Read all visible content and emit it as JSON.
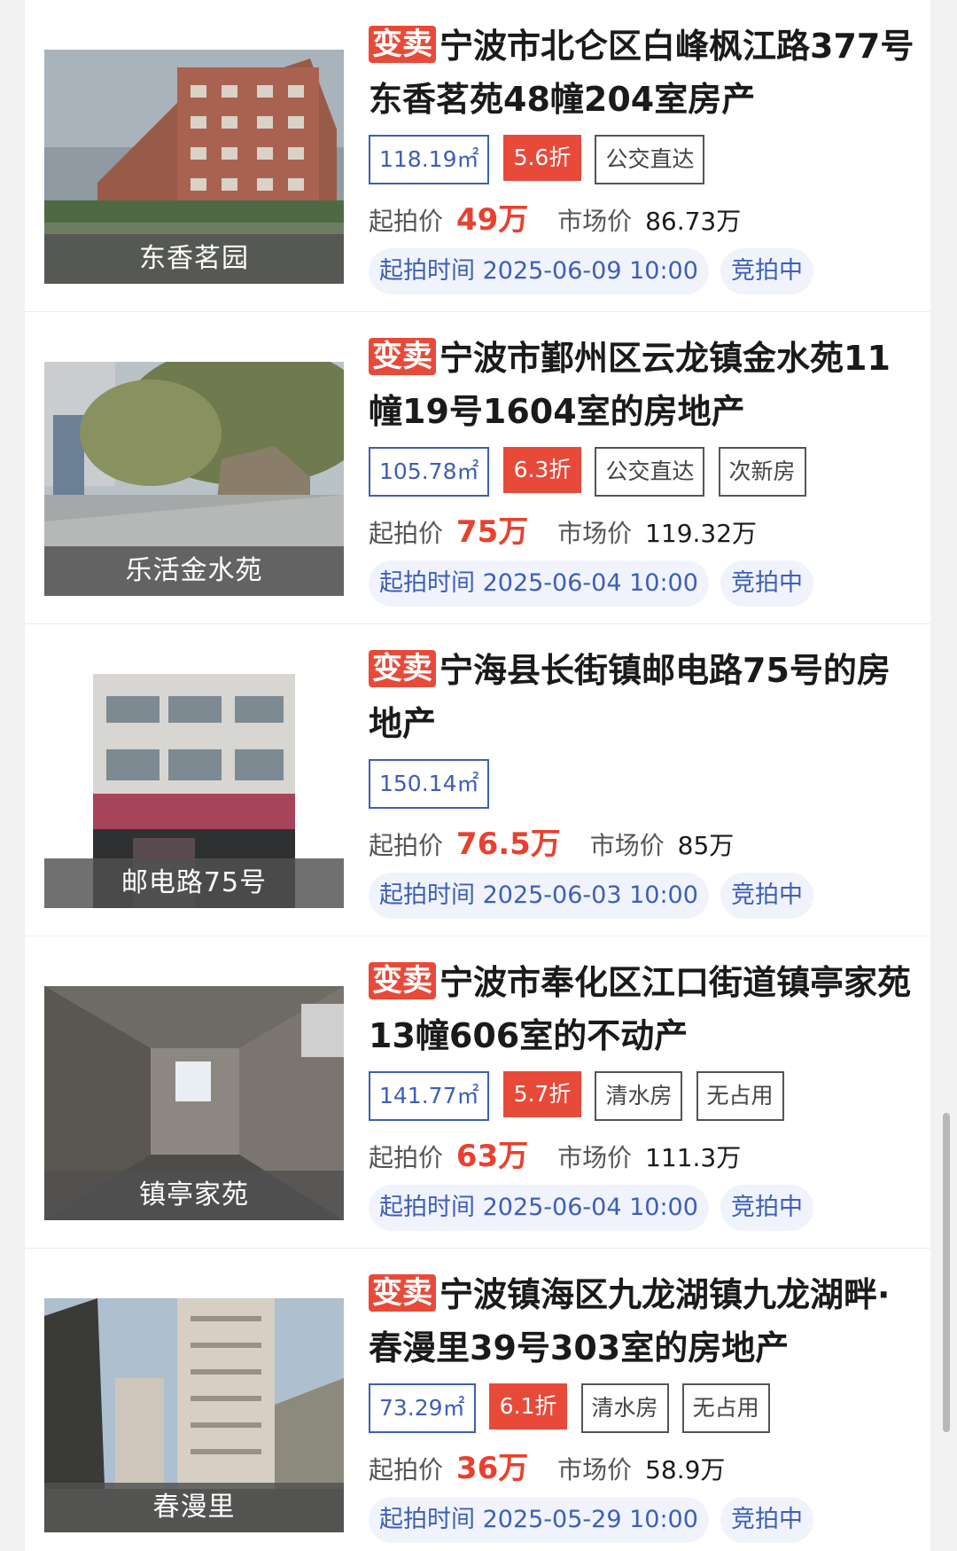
{
  "badge_label": "变卖",
  "start_price_label": "起拍价",
  "market_price_label": "市场价",
  "start_time_label": "起拍时间",
  "listings": [
    {
      "title": "宁波市北仑区白峰枫江路377号东香茗苑48幢204室房产",
      "image_label": "东香茗园",
      "tags": [
        {
          "text": "118.19㎡",
          "kind": "area"
        },
        {
          "text": "5.6折",
          "kind": "discount"
        },
        {
          "text": "公交直达",
          "kind": "plain"
        }
      ],
      "start_price": "49万",
      "market_price": "86.73万",
      "start_time": "2025-06-09 10:00",
      "status": "竞拍中"
    },
    {
      "title": "宁波市鄞州区云龙镇金水苑11幢19号1604室的房地产",
      "image_label": "乐活金水苑",
      "tags": [
        {
          "text": "105.78㎡",
          "kind": "area"
        },
        {
          "text": "6.3折",
          "kind": "discount"
        },
        {
          "text": "公交直达",
          "kind": "plain"
        },
        {
          "text": "次新房",
          "kind": "plain"
        }
      ],
      "start_price": "75万",
      "market_price": "119.32万",
      "start_time": "2025-06-04 10:00",
      "status": "竞拍中"
    },
    {
      "title": "宁海县长街镇邮电路75号的房地产",
      "image_label": "邮电路75号",
      "tags": [
        {
          "text": "150.14㎡",
          "kind": "area"
        }
      ],
      "start_price": "76.5万",
      "market_price": "85万",
      "start_time": "2025-06-03 10:00",
      "status": "竞拍中"
    },
    {
      "title": "宁波市奉化区江口街道镇亭家苑13幢606室的不动产",
      "image_label": "镇亭家苑",
      "tags": [
        {
          "text": "141.77㎡",
          "kind": "area"
        },
        {
          "text": "5.7折",
          "kind": "discount"
        },
        {
          "text": "清水房",
          "kind": "plain"
        },
        {
          "text": "无占用",
          "kind": "plain"
        }
      ],
      "start_price": "63万",
      "market_price": "111.3万",
      "start_time": "2025-06-04 10:00",
      "status": "竞拍中"
    },
    {
      "title": "宁波镇海区九龙湖镇九龙湖畔·春漫里39号303室的房地产",
      "image_label": "春漫里",
      "tags": [
        {
          "text": "73.29㎡",
          "kind": "area"
        },
        {
          "text": "6.1折",
          "kind": "discount"
        },
        {
          "text": "清水房",
          "kind": "plain"
        },
        {
          "text": "无占用",
          "kind": "plain"
        }
      ],
      "start_price": "36万",
      "market_price": "58.9万",
      "start_time": "2025-05-29 10:00",
      "status": "竞拍中"
    }
  ],
  "colors": {
    "accent_red": "#e84a3a",
    "price_red": "#e8412f",
    "link_blue": "#3d5fb5",
    "pill_bg": "#f0f3fc"
  }
}
